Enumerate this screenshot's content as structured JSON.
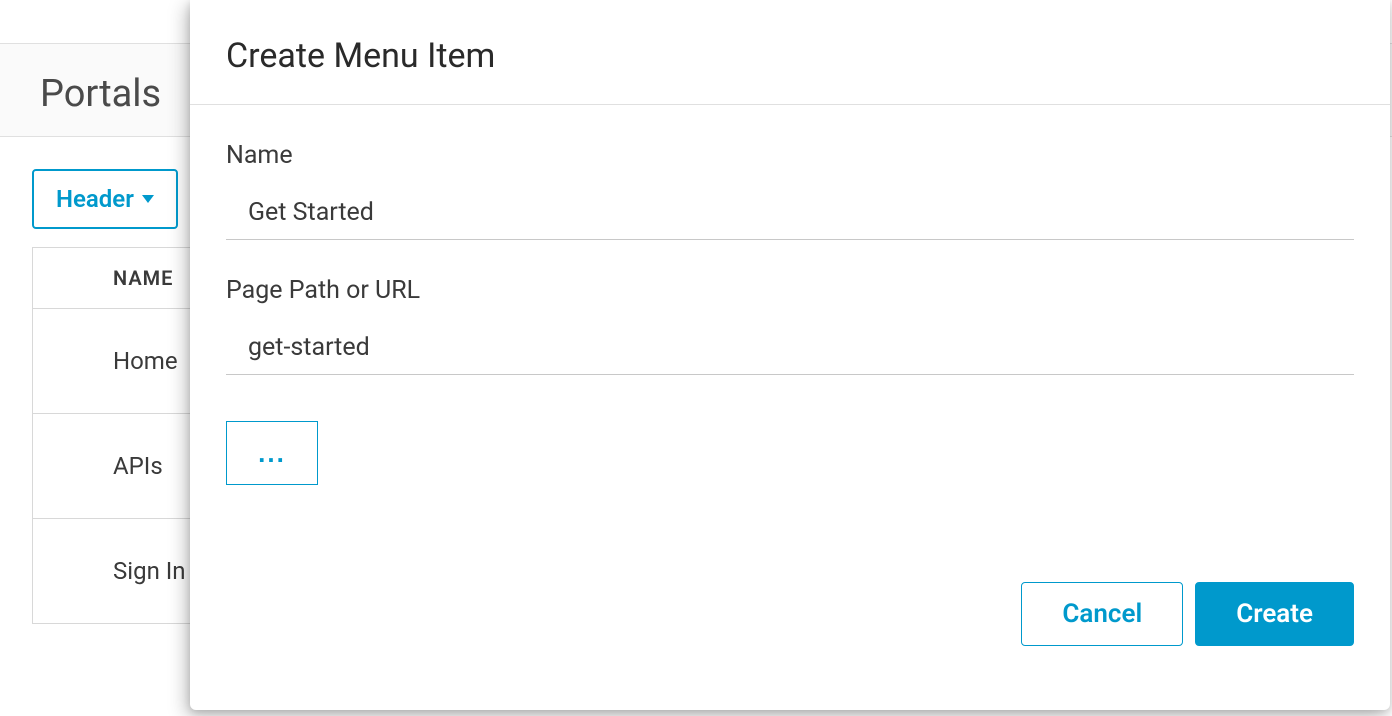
{
  "page": {
    "title": "Portals"
  },
  "dropdown": {
    "label": "Header"
  },
  "table": {
    "header": "NAME",
    "rows": [
      {
        "name": "Home"
      },
      {
        "name": "APIs"
      },
      {
        "name": "Sign In"
      }
    ]
  },
  "modal": {
    "title": "Create Menu Item",
    "name_label": "Name",
    "name_value": "Get Started",
    "path_label": "Page Path or URL",
    "path_value": "get-started",
    "more_label": "...",
    "cancel_label": "Cancel",
    "create_label": "Create"
  }
}
